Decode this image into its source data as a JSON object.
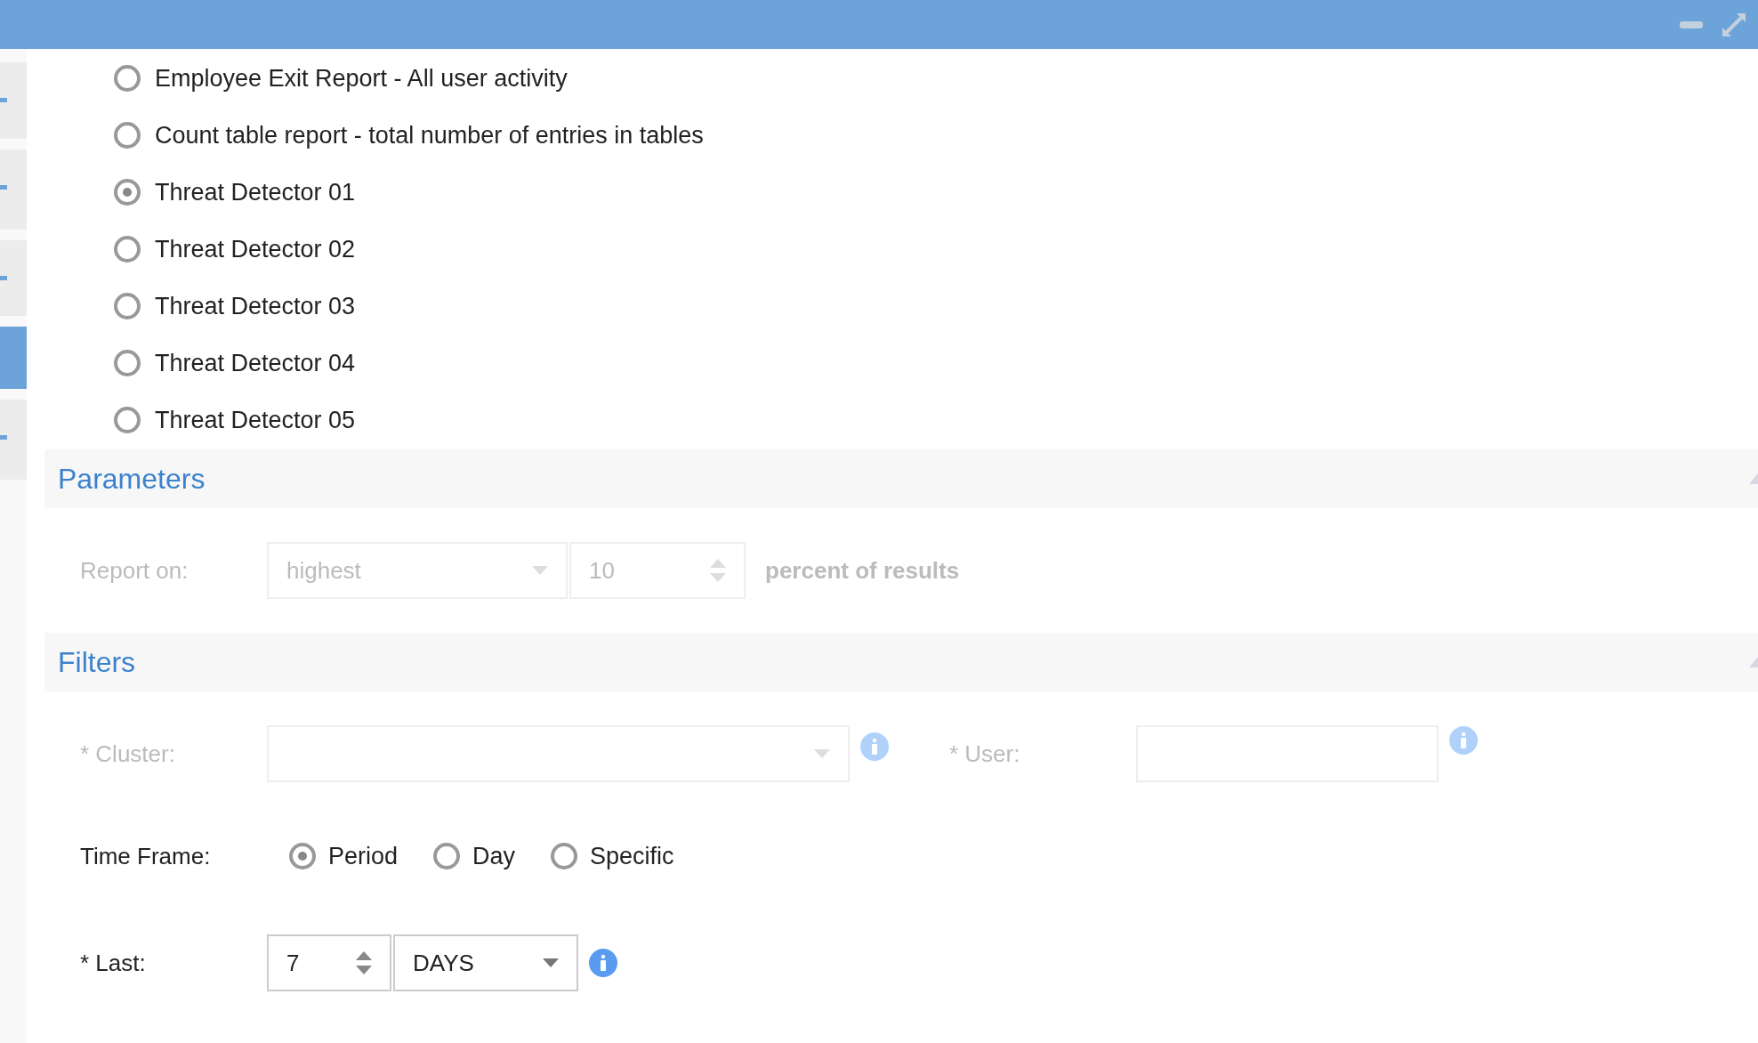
{
  "side_tabs": [
    {
      "selected": false
    },
    {
      "selected": false
    },
    {
      "selected": false
    },
    {
      "selected": true
    },
    {
      "selected": false
    }
  ],
  "reports": [
    {
      "label": "Employee Exit Report - All user activity",
      "selected": false
    },
    {
      "label": "Count table report - total number of entries in tables",
      "selected": false
    },
    {
      "label": "Threat Detector 01",
      "selected": true
    },
    {
      "label": "Threat Detector 02",
      "selected": false
    },
    {
      "label": "Threat Detector 03",
      "selected": false
    },
    {
      "label": "Threat Detector 04",
      "selected": false
    },
    {
      "label": "Threat Detector 05",
      "selected": false
    }
  ],
  "parameters": {
    "title": "Parameters",
    "disabled": true,
    "report_on": {
      "label": "Report on:",
      "select_value": "highest",
      "number_value": "10",
      "suffix": "percent of results"
    }
  },
  "filters": {
    "title": "Filters",
    "cluster": {
      "label": "* Cluster:",
      "disabled": true
    },
    "user": {
      "label": "* User:",
      "disabled": true
    },
    "time_frame": {
      "label": "Time Frame:",
      "options": [
        {
          "label": "Period",
          "selected": true
        },
        {
          "label": "Day",
          "selected": false
        },
        {
          "label": "Specific",
          "selected": false
        }
      ]
    },
    "last": {
      "label": "* Last:",
      "number_value": "7",
      "unit_value": "DAYS"
    }
  }
}
